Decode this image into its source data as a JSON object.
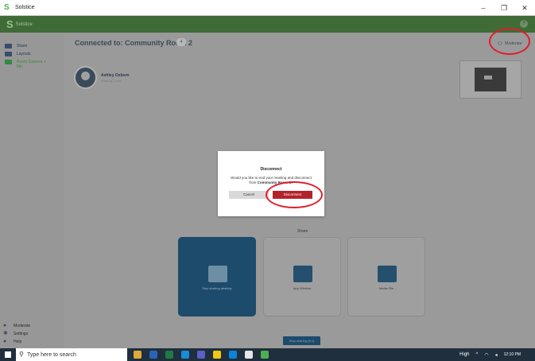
{
  "window": {
    "title": "Solstice",
    "minimize": "–",
    "maximize": "❐",
    "close": "✕"
  },
  "topbar": {
    "logo": "S",
    "brand": "Solstice",
    "help": "?"
  },
  "sidebar": {
    "items": [
      {
        "label": "Share",
        "icon": "share-icon"
      },
      {
        "label": "Layouts",
        "icon": "layout-icon"
      },
      {
        "label": "Room Camera + Mic",
        "icon": "camera-icon"
      }
    ],
    "bottom": [
      {
        "label": "Moderate",
        "icon": "people-icon"
      },
      {
        "label": "Settings",
        "icon": "gear-icon"
      },
      {
        "label": "Help",
        "icon": "help-icon"
      }
    ]
  },
  "main": {
    "title": "Connected to: Community Room 2",
    "badge": "4",
    "moderate_label": "Moderate",
    "user": {
      "name": "Ashley Osborn",
      "status": "Sharing 1 post"
    },
    "share_label": "Share",
    "cards": [
      {
        "label": "Stop sharing desktop",
        "active": true
      },
      {
        "label": "App Window",
        "active": false
      },
      {
        "label": "Media File",
        "active": false
      }
    ],
    "stop_sharing": "Stop sharing (6:1)"
  },
  "modal": {
    "title": "Disconnect",
    "body_prefix": "Would you like to end your meeting and disconnect from ",
    "body_bold": "Community Room 2",
    "body_suffix": "?",
    "cancel": "Cancel",
    "confirm": "Disconnect"
  },
  "taskbar": {
    "search_placeholder": "Type here to search",
    "weather": "High",
    "time": "12:10 PM"
  },
  "colors": {
    "accent_green": "#3f6b37",
    "danger": "#b3232c",
    "annotation": "#e01e2c"
  }
}
